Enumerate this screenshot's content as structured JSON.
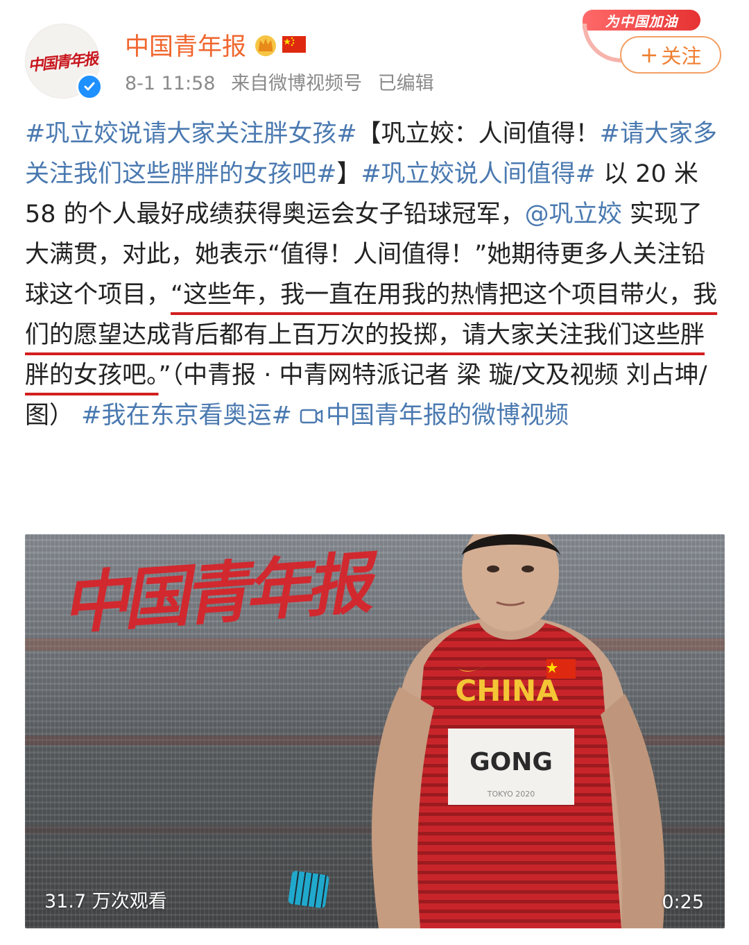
{
  "header": {
    "avatar_text": "中国青年报",
    "username": "中国青年报",
    "timestamp": "8-1 11:58",
    "source": "来自微博视频号",
    "edited": "已编辑",
    "follow_label": "关注",
    "follow_plus": "+",
    "cheer_banner": "为中国加油"
  },
  "post": {
    "tag1": "#巩立姣说请大家关注胖女孩#",
    "text1": "【巩立姣：人间值得！",
    "tag2": "#请大家多关注我们这些胖胖的女孩吧#",
    "text2": "】",
    "tag3": "#巩立姣说人间值得#",
    "text3": " 以 20 米 58 的个人最好成绩获得奥运会女子铅球冠军，",
    "mention": "@巩立姣",
    "text4": " 实现了大满贯，对此，她表示“值得！人间值得！”她期待更多人关注铅球这个项目，",
    "highlight": "“这些年，我一直在用我的热情把这个项目带火，我们的愿望达成背后都有上百万次的投掷，请大家关注我们这些胖胖的女孩吧。",
    "text5": "”（中青报 · 中青网特派记者 梁 璇/文及视频 刘占坤/图）",
    "tag4": "#我在东京看奥运#",
    "video_link_icon": "video-link-icon",
    "video_link": "中国青年报的微博视频"
  },
  "video": {
    "watermark": "中国青年报",
    "jersey_text": "CHINA",
    "bib_name": "GONG",
    "bib_sub": "TOKYO 2020",
    "views": "31.7 万次观看",
    "duration": "0:25"
  },
  "colors": {
    "username": "#f0662e",
    "link": "#4a79b0",
    "highlight_underline": "#d21f1f",
    "follow": "#f07f31",
    "jersey": "#c8252a"
  }
}
